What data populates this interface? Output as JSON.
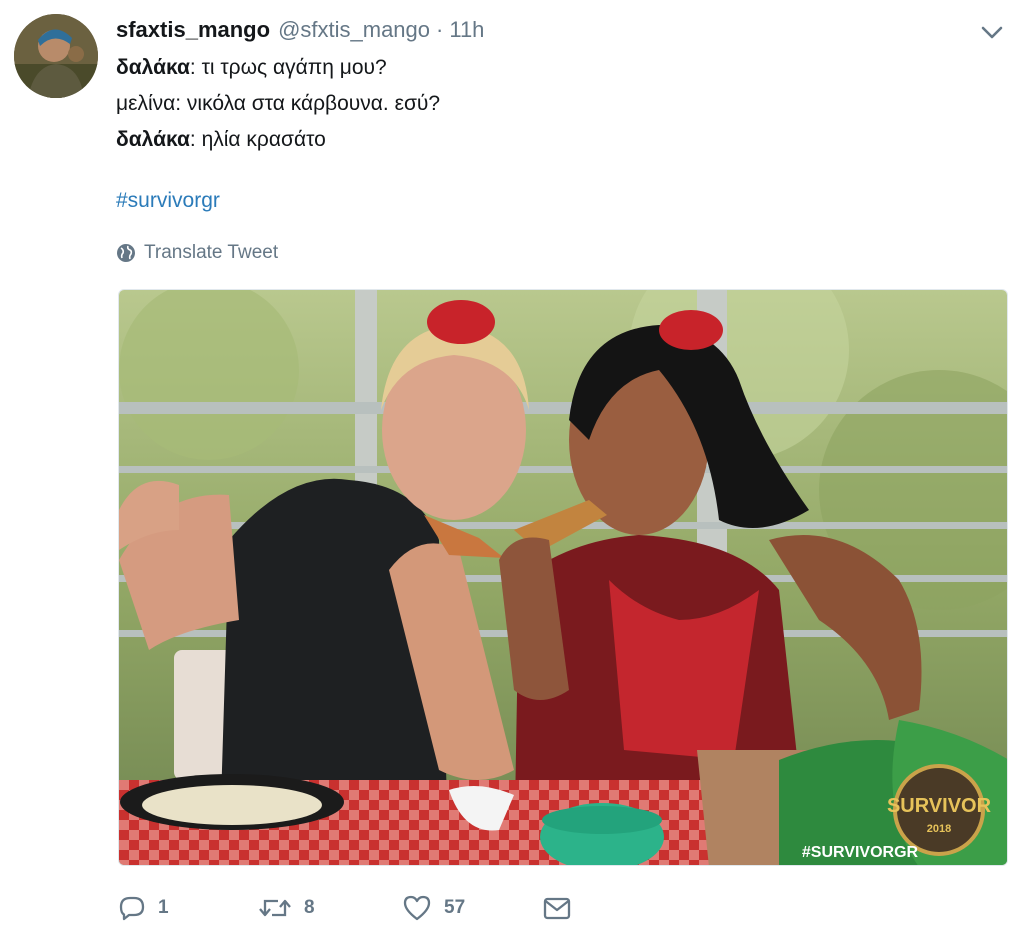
{
  "tweet": {
    "display_name": "sfaxtis_mango",
    "handle": "@sfxtis_mango",
    "separator": "·",
    "time": "11h",
    "lines": [
      {
        "speaker": "δαλάκα",
        "text": ": τι τρως αγάπη μου?"
      },
      {
        "speaker": "",
        "text": "μελίνα: νικόλα στα κάρβουνα. εσύ?"
      },
      {
        "speaker": "δαλάκα",
        "text": ": ηλία κρασάτο"
      }
    ],
    "hashtag": "#survivorgr",
    "translate_label": "Translate Tweet"
  },
  "media": {
    "watermark": "#SURVIVORGR",
    "logo_text": "SURVIVOR",
    "logo_year": "2018"
  },
  "actions": {
    "reply_count": "1",
    "retweet_count": "8",
    "like_count": "57"
  },
  "icons": {
    "reply": "reply-icon",
    "retweet": "retweet-icon",
    "like": "heart-icon",
    "dm": "envelope-icon",
    "caret": "chevron-down-icon",
    "translate": "globe-icon"
  },
  "colors": {
    "link": "#1b95e0",
    "secondary_text": "#657786",
    "primary_text": "#14171a"
  }
}
